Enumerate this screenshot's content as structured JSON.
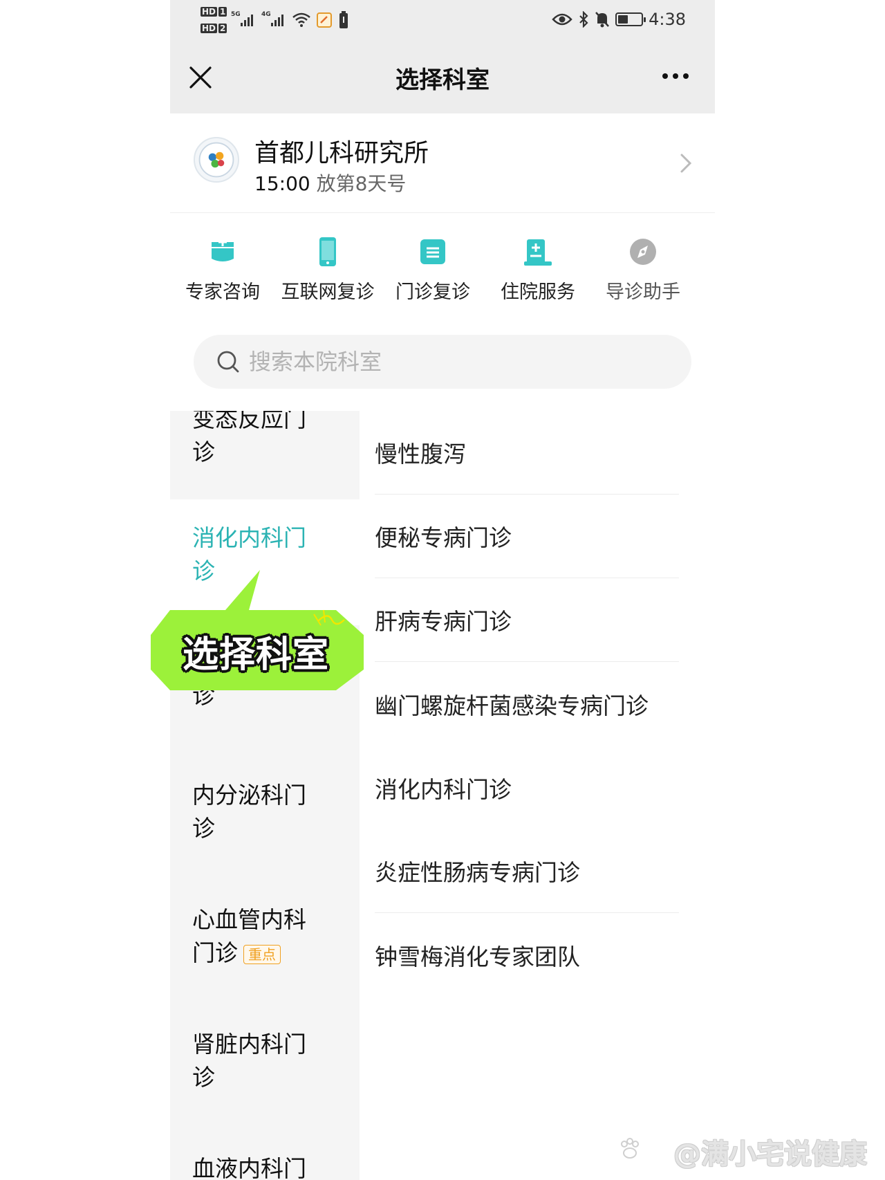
{
  "status_bar": {
    "time": "4:38",
    "hd1": "HD",
    "hd1_num": "1",
    "hd2": "HD",
    "hd2_num": "2",
    "net1": "5G",
    "net2": "4G"
  },
  "header": {
    "title": "选择科室"
  },
  "hospital": {
    "name": "首都儿科研究所",
    "release_time": "15:00",
    "release_rule": "放第8天号"
  },
  "services": [
    {
      "label": "专家咨询",
      "icon": "consult-icon",
      "color": "#34c6c6"
    },
    {
      "label": "互联网复诊",
      "icon": "phone-icon",
      "color": "#34c6c6"
    },
    {
      "label": "门诊复诊",
      "icon": "list-icon",
      "color": "#34c6c6"
    },
    {
      "label": "住院服务",
      "icon": "hospital-bed-icon",
      "color": "#34c6c6"
    },
    {
      "label": "导诊助手",
      "icon": "compass-icon",
      "color": "#b0b0b0"
    }
  ],
  "search": {
    "placeholder": "搜索本院科室"
  },
  "categories": [
    {
      "line1": "变态反应门",
      "line2": "诊"
    },
    {
      "line1": "消化内科门",
      "line2": "诊"
    },
    {
      "line2": "诊"
    },
    {
      "line1": "内分泌科门",
      "line2": "诊"
    },
    {
      "line1": "心血管内科",
      "line2": "门诊",
      "tag": "重点"
    },
    {
      "line1": "肾脏内科门",
      "line2": "诊"
    },
    {
      "line1": "血液内科门"
    }
  ],
  "departments": [
    "慢性腹泻",
    "便秘专病门诊",
    "肝病专病门诊",
    "幽门螺旋杆菌感染专病门诊",
    "消化内科门诊",
    "炎症性肠病专病门诊",
    "钟雪梅消化专家团队"
  ],
  "callout": {
    "text": "选择科室"
  },
  "watermark": {
    "text": "@满小宅说健康"
  },
  "colors": {
    "accent": "#2bb3b3",
    "callout_green": "#9cf13a",
    "tag_orange": "#f0a020"
  }
}
